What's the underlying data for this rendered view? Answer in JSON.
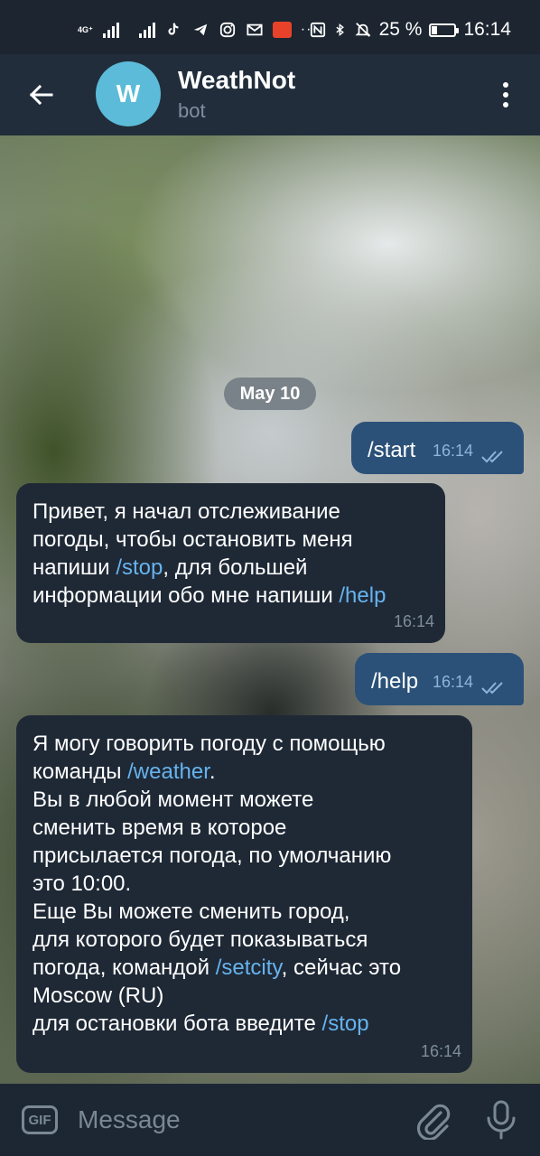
{
  "status_bar": {
    "network_label": "4G⁺",
    "battery_percent": "25 %",
    "battery_level": 0.25,
    "time": "16:14",
    "icons_left": [
      "signal-icon",
      "signal-icon",
      "tiktok-icon",
      "telegram-icon",
      "instagram-icon",
      "mail-icon",
      "aliexpress-icon",
      "more-icon"
    ],
    "more_dots": "···",
    "icons_right": [
      "nfc-icon",
      "bluetooth-icon",
      "mute-icon",
      "battery-icon"
    ]
  },
  "header": {
    "back_icon": "arrow-left-icon",
    "avatar_letter": "W",
    "avatar_color": "#5cbbd8",
    "title": "WeathNot",
    "subtitle": "bot",
    "menu_icon": "more-vertical-icon"
  },
  "chat": {
    "date": "May 10",
    "messages": [
      {
        "direction": "out",
        "text": "/start",
        "time": "16:14",
        "status": "read"
      },
      {
        "direction": "in",
        "parts": [
          "Привет, я начал  отслеживание\nпогоды, чтобы остановить меня\nнапиши ",
          "/stop",
          ", для большей\nинформации обо мне напиши ",
          "/help"
        ],
        "time": "16:14"
      },
      {
        "direction": "out",
        "text": "/help",
        "time": "16:14",
        "status": "read"
      },
      {
        "direction": "in",
        "parts": [
          "Я могу говорить погоду с помощью\nкоманды ",
          "/weather",
          ".\n Вы в любой момент можете\nсменить время в которое\nприсылается погода, по умолчанию\nэто 10:00.\n Еще Вы можете сменить город,\nдля которого будет показываться\nпогода, командой ",
          "/setcity",
          ", сейчас это\nMoscow (RU)\nдля остановки бота введите ",
          "/stop"
        ],
        "time": "16:14"
      }
    ]
  },
  "input_bar": {
    "gif_label": "GIF",
    "placeholder": "Message",
    "value": "",
    "attach_icon": "paperclip-icon",
    "mic_icon": "microphone-icon"
  },
  "colors": {
    "header_bg": "#212d3b",
    "incoming_bubble": "#1f2936",
    "outgoing_bubble": "#2b5178",
    "command_link": "#66b3ee"
  }
}
